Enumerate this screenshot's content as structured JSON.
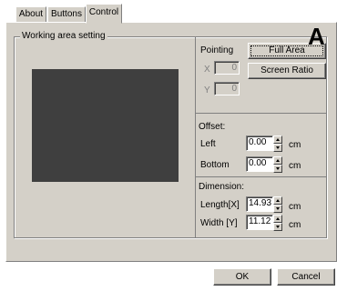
{
  "tabs": [
    {
      "label": "About"
    },
    {
      "label": "Buttons"
    },
    {
      "label": "Control",
      "active": true
    }
  ],
  "working_area": {
    "title": "Working area setting"
  },
  "annotation": "A",
  "pointing": {
    "title": "Pointing",
    "x_label": "X",
    "x_value": "0",
    "y_label": "Y",
    "y_value": "0"
  },
  "buttons": {
    "full_area": "Full Area",
    "screen_ratio": "Screen Ratio",
    "ok": "OK",
    "cancel": "Cancel"
  },
  "offset": {
    "title": "Offset:",
    "left_label": "Left",
    "left_value": "0.00",
    "bottom_label": "Bottom",
    "bottom_value": "0.00",
    "unit": "cm"
  },
  "dimension": {
    "title": "Dimension:",
    "length_label": "Length[X]",
    "length_value": "14.93",
    "width_label": "Width [Y]",
    "width_value": "11.12",
    "unit": "cm"
  },
  "colors": {
    "dialog_bg": "#d4d0c8",
    "preview_area": "#3f3f3f"
  }
}
